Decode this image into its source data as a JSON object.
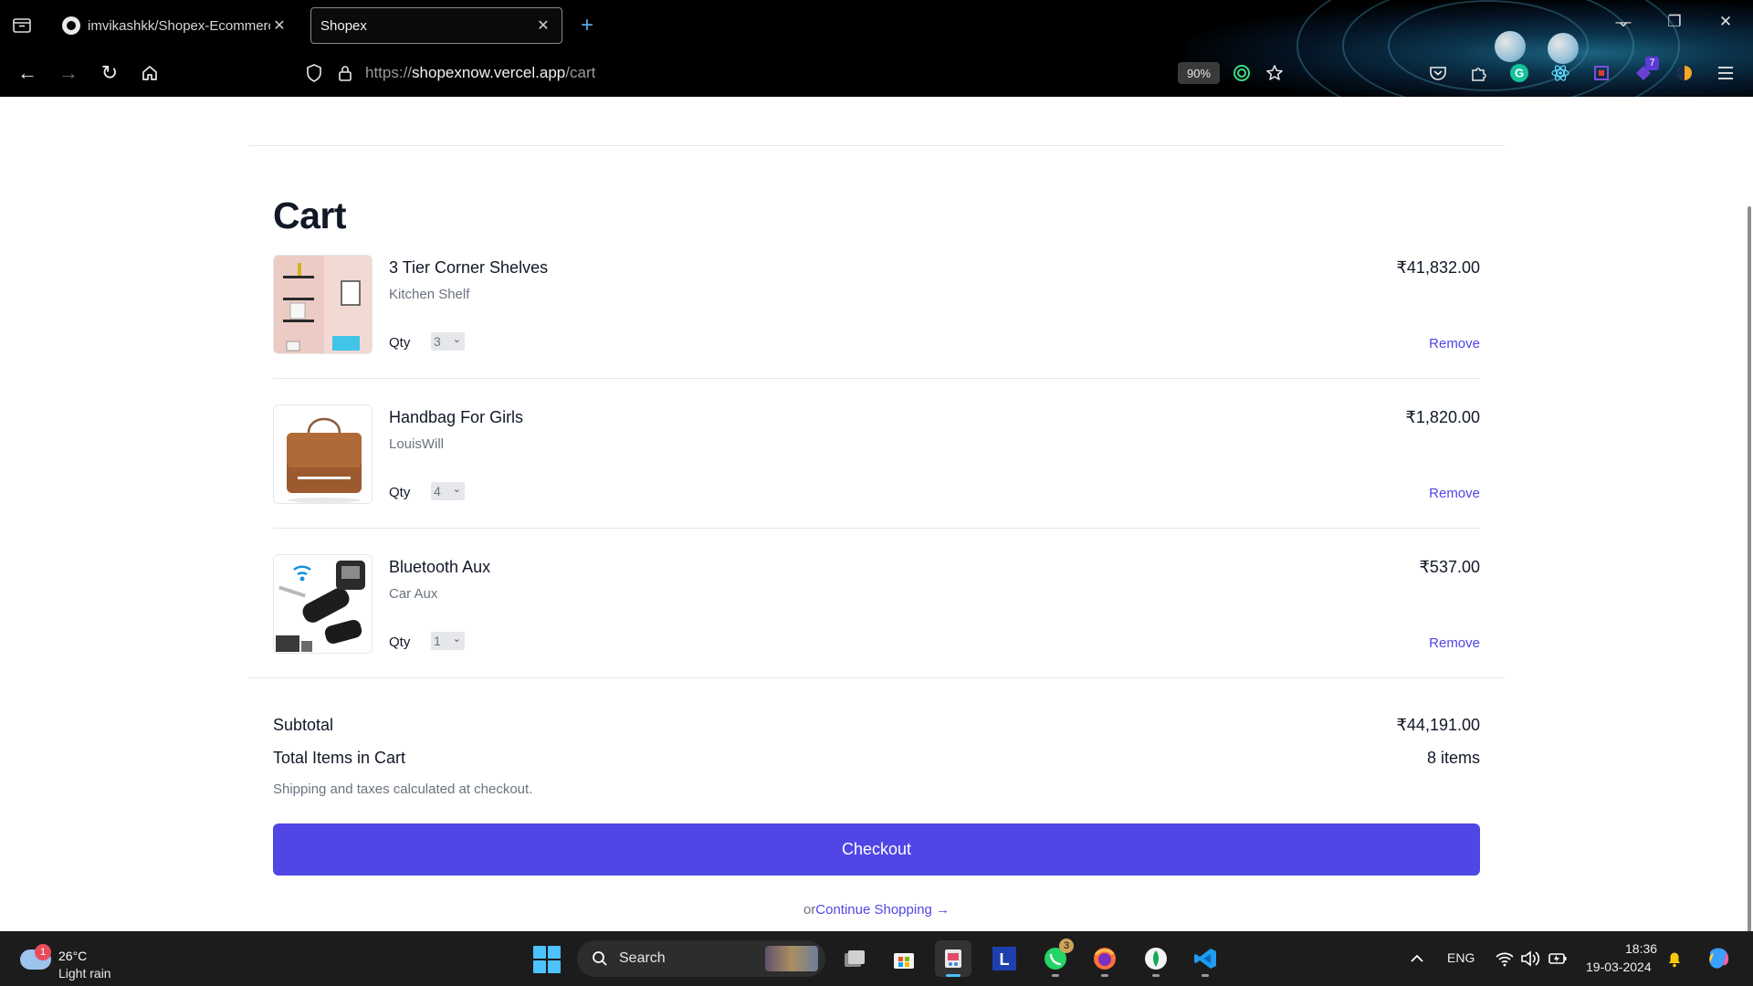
{
  "browser": {
    "tabs": [
      {
        "title": "imvikashkk/Shopex-Ecommerce",
        "active": false
      },
      {
        "title": "Shopex",
        "active": true
      }
    ],
    "url": {
      "prefix": "https://",
      "host": "shopexnow.vercel.app",
      "path": "/cart"
    },
    "zoom": "90%",
    "extension_badge": "7",
    "colors": {
      "chrome_bg": "#000000",
      "new_tab_plus": "#5aa9e6"
    }
  },
  "page": {
    "title": "Cart",
    "items": [
      {
        "name": "3 Tier Corner Shelves",
        "brand": "Kitchen Shelf",
        "qty_label": "Qty",
        "qty": "3",
        "price": "₹41,832.00",
        "remove_label": "Remove",
        "image_icon": "shelves-image"
      },
      {
        "name": "Handbag For Girls",
        "brand": "LouisWill",
        "qty_label": "Qty",
        "qty": "4",
        "price": "₹1,820.00",
        "remove_label": "Remove",
        "image_icon": "handbag-image"
      },
      {
        "name": "Bluetooth Aux",
        "brand": "Car Aux",
        "qty_label": "Qty",
        "qty": "1",
        "price": "₹537.00",
        "remove_label": "Remove",
        "image_icon": "bluetooth-aux-image"
      }
    ],
    "summary": {
      "subtotal_label": "Subtotal",
      "subtotal_value": "₹44,191.00",
      "total_items_label": "Total Items in Cart",
      "total_items_value": "8 items",
      "shipping_note": "Shipping and taxes calculated at checkout."
    },
    "checkout_label": "Checkout",
    "continue_prefix": "or",
    "continue_label": "Continue Shopping →",
    "colors": {
      "accent": "#4f46e5",
      "text": "#111827",
      "muted": "#6b7280"
    }
  },
  "taskbar": {
    "weather": {
      "temp": "26°C",
      "condition": "Light rain",
      "badge": "1"
    },
    "search_label": "Search",
    "whatsapp_badge": "3",
    "language": "ENG",
    "time": "18:36",
    "date": "19-03-2024"
  }
}
